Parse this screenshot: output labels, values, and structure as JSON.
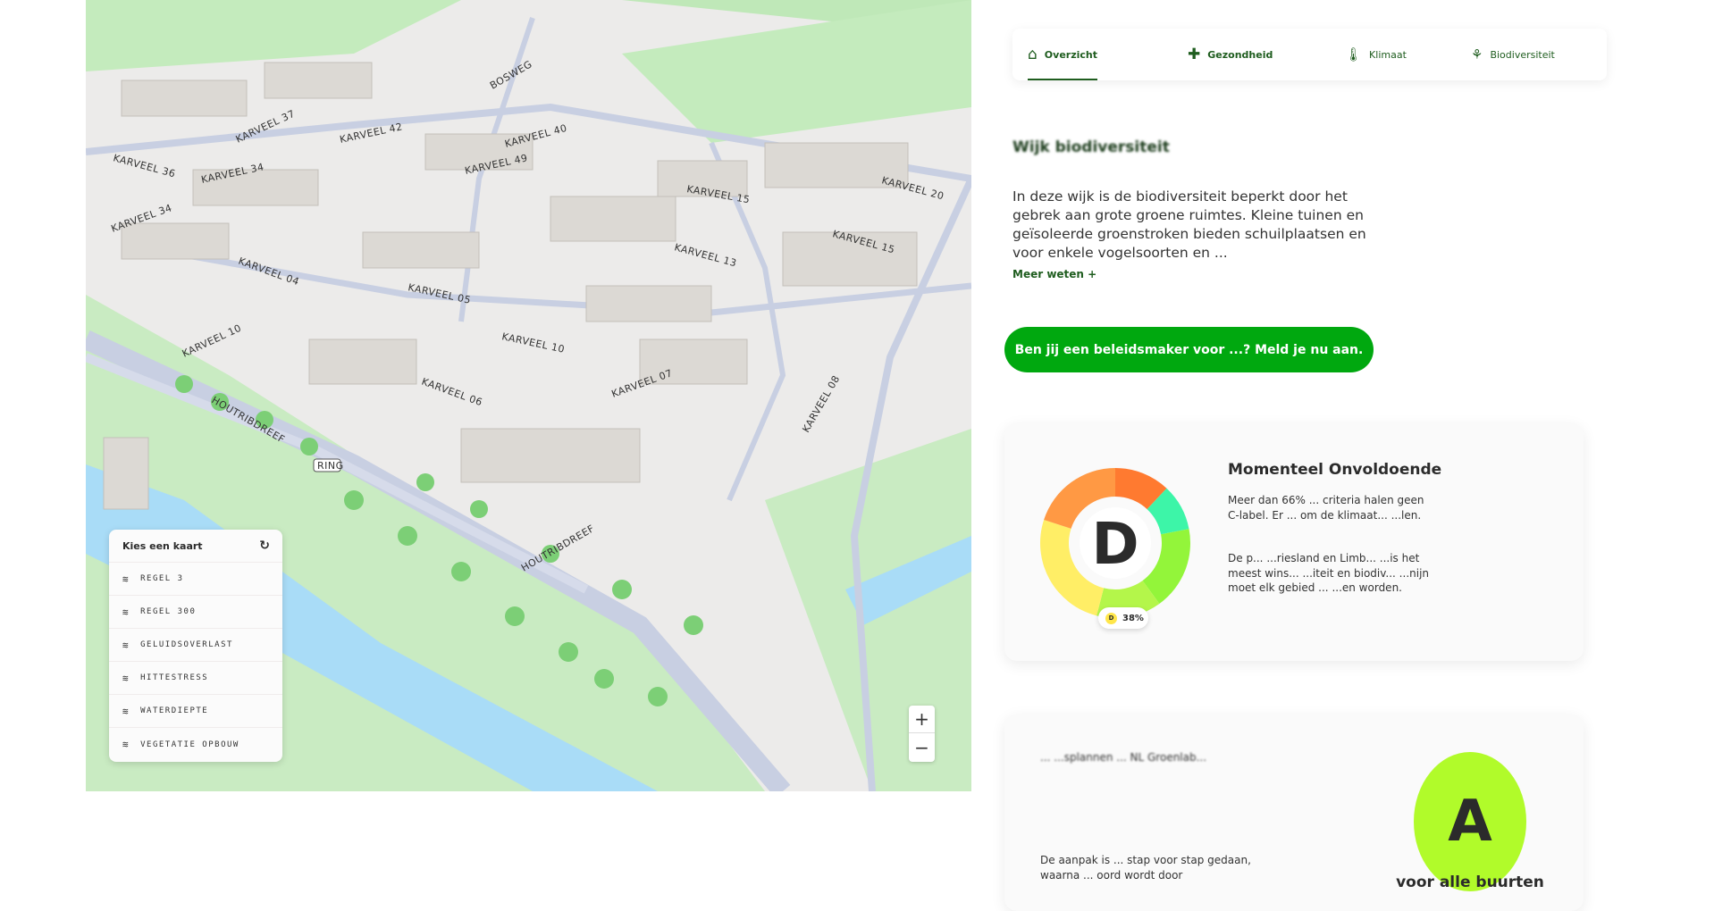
{
  "map": {
    "street_labels": [
      "KARVEEL 36",
      "KARVEEL 34",
      "KARVEEL 42",
      "KARVEEL 40",
      "KARVEEL 37",
      "KARVEEL 34",
      "KARVEEL 04",
      "KARVEEL 05",
      "KARVEEL 10",
      "KARVEEL 10",
      "KARVEEL 06",
      "KARVEEL 07",
      "KARVEEL 08",
      "KARVEEL 15",
      "KARVEEL 13",
      "KARVEEL 15",
      "KARVEEL 20",
      "KARVEEL 49",
      "HOUTRIBDREEF",
      "HOUTRIBDREEF",
      "BOSWEG",
      "RING"
    ],
    "layer_panel": {
      "title": "Kies een kaart",
      "items": [
        "REGEL 3",
        "REGEL 300",
        "GELUIDSOVERLAST",
        "HITTESTRESS",
        "WATERDIEPTE",
        "VEGETATIE OPBOUW"
      ]
    },
    "zoom_in": "+",
    "zoom_out": "−"
  },
  "tabs": [
    {
      "label": "Overzicht",
      "icon": "home-icon",
      "active": true
    },
    {
      "label": "Gezondheid",
      "icon": "cross-icon"
    },
    {
      "label": "Klimaat",
      "icon": "thermometer-icon"
    },
    {
      "label": "Biodiversiteit",
      "icon": "plant-icon"
    }
  ],
  "intro": {
    "title": "Wijk biodiversiteit",
    "text": "In deze wijk is de biodiversiteit beperkt door het gebrek aan grote groene ruimtes. Kleine tuinen en geïsoleerde groenstroken bieden schuilplaatsen en voor enkele vogelsoorten en ...",
    "more": "Meer weten +"
  },
  "cta": "Ben jij een beleidsmaker voor ...? Meld je nu aan.",
  "score_card": {
    "grade": "D",
    "title": "Momenteel Onvoldoende",
    "p1": "Meer dan 66% ... criteria halen geen C-label. Er ... om de klimaat... ...len.",
    "p2": "De p... ...riesland en Limb... ...is het meest wins... ...iteit en biodiv... ...nijn moet elk gebied ... ...en worden.",
    "tooltip_grade": "D",
    "tooltip_value": "38%",
    "segments": [
      {
        "color": "#ff7a30",
        "value": 12
      },
      {
        "color": "#3df5a8",
        "value": 10
      },
      {
        "color": "#93f53a",
        "value": 18
      },
      {
        "color": "#b4f64a",
        "value": 14
      },
      {
        "color": "#ffee66",
        "value": 26
      },
      {
        "color": "#ff9944",
        "value": 20
      }
    ]
  },
  "second_card": {
    "grade": "A",
    "label": "voor alle buurten",
    "p1": "... ...splannen ... NL Groenlab...",
    "p2": "De aanpak is ... stap voor stap gedaan, waarna ... oord wordt door"
  },
  "colors": {
    "accent": "#00a80f",
    "dark_green": "#1f5d1f"
  }
}
